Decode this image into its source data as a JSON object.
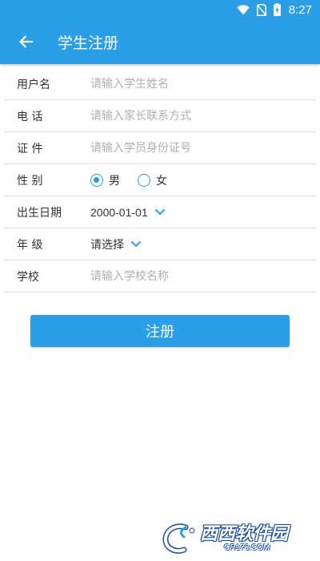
{
  "status_bar": {
    "time": "8:27",
    "icons": [
      "wifi-icon",
      "no-sim-icon",
      "battery-charging-icon"
    ]
  },
  "toolbar": {
    "back_icon": "arrow-left-icon",
    "title": "学生注册"
  },
  "form": {
    "username": {
      "label": "用户名",
      "placeholder": "请输入学生姓名",
      "value": ""
    },
    "phone": {
      "label": "电 话",
      "placeholder": "请输入家长联系方式",
      "value": ""
    },
    "id_card": {
      "label": "证 件",
      "placeholder": "请输入学员身份证号",
      "value": ""
    },
    "gender": {
      "label": "性 别",
      "options": [
        {
          "label": "男",
          "checked": true
        },
        {
          "label": "女",
          "checked": false
        }
      ]
    },
    "birthdate": {
      "label": "出生日期",
      "value": "2000-01-01",
      "icon": "chevron-down-icon"
    },
    "grade": {
      "label": "年 级",
      "value": "请选择",
      "icon": "chevron-down-icon"
    },
    "school": {
      "label": "学校",
      "placeholder": "请输入学校名称",
      "value": ""
    }
  },
  "submit_label": "注册",
  "watermark": {
    "main": "西西软件园",
    "sub": "CR173.COM"
  },
  "colors": {
    "primary": "#2b9ee8",
    "divider": "#e3e3e3",
    "placeholder": "#b0b0b0",
    "text": "#333333"
  }
}
